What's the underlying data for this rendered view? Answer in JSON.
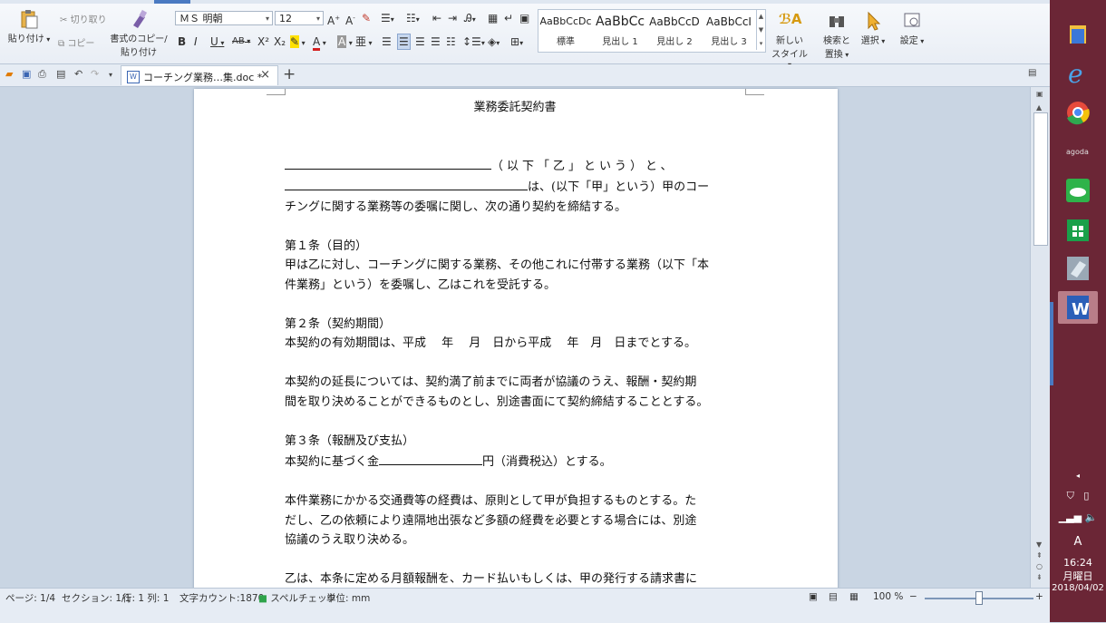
{
  "ribbon": {
    "paste_label": "貼り付け",
    "cut_label": "切り取り",
    "copy_label": "コピー",
    "format_copy_label_1": "書式のコピー/",
    "format_copy_label_2": "貼り付け",
    "font_name": "ＭＳ 明朝",
    "font_size": "12",
    "bold": "B",
    "italic": "I",
    "underline": "U",
    "strike": "AB",
    "superscript": "X²",
    "subscript": "X₂",
    "styles": [
      {
        "sample": "AaBbCcDc",
        "name": "標準"
      },
      {
        "sample": "AaBbCc",
        "name": "見出し 1"
      },
      {
        "sample": "AaBbCcD",
        "name": "見出し 2"
      },
      {
        "sample": "AaBbCcI",
        "name": "見出し 3"
      }
    ],
    "new_style_label_1": "新しい",
    "new_style_label_2": "スタイル",
    "find_label_1": "検索と",
    "find_label_2": "置換",
    "select_label": "選択",
    "settings_label": "設定"
  },
  "tabbar": {
    "doc_tab_label": "コーチング業務…集.doc *",
    "add_tab": "+"
  },
  "document": {
    "title": "業務委託契約書",
    "intro_line1_suffix": "（以下「乙」という）と、",
    "intro_line2_suffix": "は、(以下「甲」という）甲のコー",
    "intro_line3": "チングに関する業務等の委嘱に関し、次の通り契約を締結する。",
    "art1_heading": "第１条（目的）",
    "art1_line1": "甲は乙に対し、コーチングに関する業務、その他これに付帯する業務（以下「本",
    "art1_line2": "件業務」という）を委嘱し、乙はこれを受託する。",
    "art2_heading": "第２条（契約期間）",
    "art2_line1": "本契約の有効期間は、平成　 年　 月　日から平成　 年　月　日までとする。",
    "art2_p2_line1": "本契約の延長については、契約満了前までに両者が協議のうえ、報酬・契約期",
    "art2_p2_line2": "間を取り決めることができるものとし、別途書面にて契約締結することとする。",
    "art3_heading": "第３条（報酬及び支払）",
    "art3_line1_prefix": "本契約に基づく金",
    "art3_line1_suffix": "円（消費税込）とする。",
    "art3_p2_line1": "本件業務にかかる交通費等の経費は、原則として甲が負担するものとする。た",
    "art3_p2_line2": "だし、乙の依頼により遠隔地出張など多額の経費を必要とする場合には、別途",
    "art3_p2_line3": "協議のうえ取り決める。",
    "art3_p3_line1": "乙は、本条に定める月額報酬を、カード払いもしくは、甲の発行する請求書に"
  },
  "status": {
    "page": "ページ: 1/4",
    "section": "セクション: 1/1",
    "line_col": "行: 1  列: 1",
    "word_count": "文字カウント:1870",
    "spell": "スペルチェック",
    "unit": "単位: mm",
    "zoom": "100 %",
    "zoom_level": 0.5
  },
  "taskbar": {
    "time": "16:24",
    "weekday": "月曜日",
    "date": "2018/04/02",
    "ime": "A"
  },
  "colors": {
    "taskbar_bg": "#6b2636",
    "ribbon_bg": "#eef2f7",
    "doc_bg": "#c9d5e3",
    "accent": "#4a7ac2"
  }
}
